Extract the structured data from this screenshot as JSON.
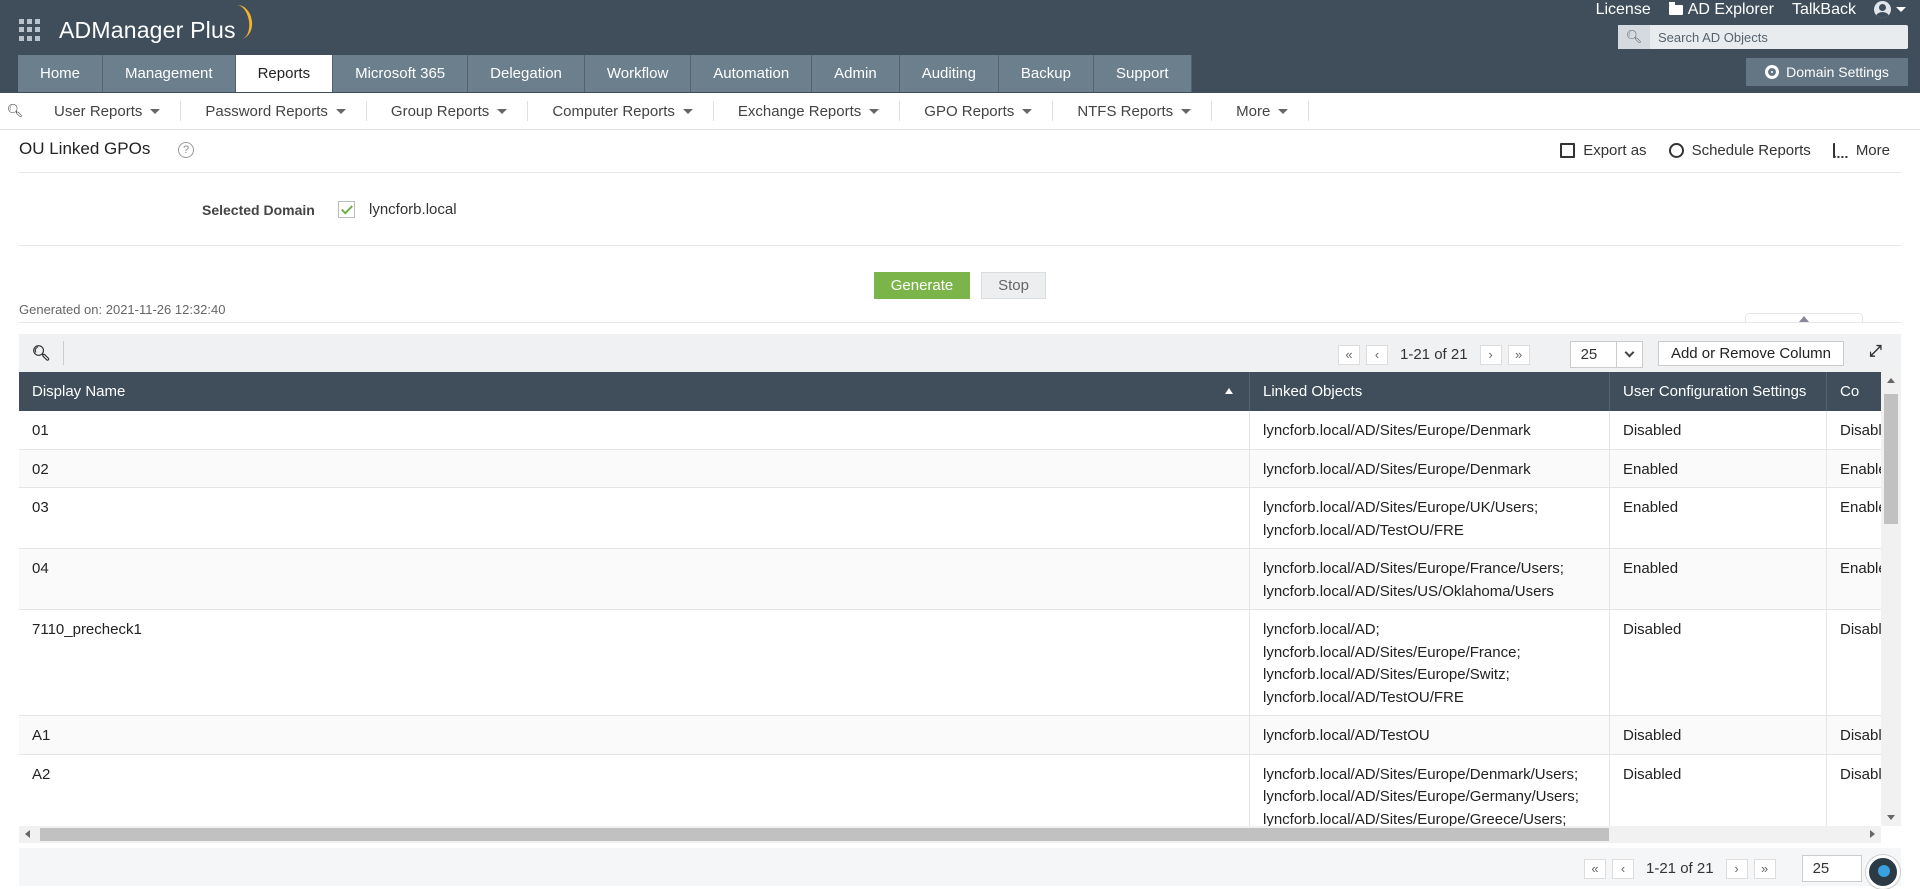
{
  "app": {
    "name": "ADManager Plus"
  },
  "top_links": [
    "License",
    "AD Explorer",
    "TalkBack"
  ],
  "search": {
    "placeholder": "Search AD Objects"
  },
  "main_tabs": [
    "Home",
    "Management",
    "Reports",
    "Microsoft 365",
    "Delegation",
    "Workflow",
    "Automation",
    "Admin",
    "Auditing",
    "Backup",
    "Support"
  ],
  "active_tab": "Reports",
  "domain_settings": "Domain Settings",
  "sub_nav": [
    "User Reports",
    "Password Reports",
    "Group Reports",
    "Computer Reports",
    "Exchange Reports",
    "GPO Reports",
    "NTFS Reports",
    "More"
  ],
  "page": {
    "title": "OU Linked GPOs",
    "help": "?",
    "actions": {
      "export": "Export as",
      "schedule": "Schedule Reports",
      "more": "More"
    }
  },
  "domain": {
    "label": "Selected Domain",
    "value": "lyncforb.local",
    "checked": true
  },
  "buttons": {
    "generate": "Generate",
    "stop": "Stop"
  },
  "generated_on": "Generated on: 2021-11-26 12:32:40",
  "pager": {
    "range": "1-21 of 21",
    "page_size": "25"
  },
  "add_column": "Add or Remove Column",
  "table": {
    "columns": [
      "Display Name",
      "Linked Objects",
      "User Configuration Settings",
      "Co"
    ],
    "rows": [
      {
        "name": "01",
        "linked": [
          "lyncforb.local/AD/Sites/Europe/Denmark"
        ],
        "user_cfg": "Disabled",
        "comp_cfg": "Disabl"
      },
      {
        "name": "02",
        "linked": [
          "lyncforb.local/AD/Sites/Europe/Denmark"
        ],
        "user_cfg": "Enabled",
        "comp_cfg": "Enable"
      },
      {
        "name": "03",
        "linked": [
          "lyncforb.local/AD/Sites/Europe/UK/Users;",
          "lyncforb.local/AD/TestOU/FRE"
        ],
        "user_cfg": "Enabled",
        "comp_cfg": "Enable"
      },
      {
        "name": "04",
        "linked": [
          "lyncforb.local/AD/Sites/Europe/France/Users;",
          "lyncforb.local/AD/Sites/US/Oklahoma/Users"
        ],
        "user_cfg": "Enabled",
        "comp_cfg": "Enable"
      },
      {
        "name": "7110_precheck1",
        "linked": [
          "lyncforb.local/AD;",
          "lyncforb.local/AD/Sites/Europe/France;",
          "lyncforb.local/AD/Sites/Europe/Switz;",
          "lyncforb.local/AD/TestOU/FRE"
        ],
        "user_cfg": "Disabled",
        "comp_cfg": "Disabl"
      },
      {
        "name": "A1",
        "linked": [
          "lyncforb.local/AD/TestOU"
        ],
        "user_cfg": "Disabled",
        "comp_cfg": "Disabl"
      },
      {
        "name": "A2",
        "linked": [
          "lyncforb.local/AD/Sites/Europe/Denmark/Users;",
          "lyncforb.local/AD/Sites/Europe/Germany/Users;",
          "lyncforb.local/AD/Sites/Europe/Greece/Users;"
        ],
        "user_cfg": "Disabled",
        "comp_cfg": "Disabl"
      }
    ]
  },
  "colors": {
    "header_bg": "#3f4e5a",
    "tab_bg": "#6c7f8c",
    "generate": "#7bb54a"
  }
}
